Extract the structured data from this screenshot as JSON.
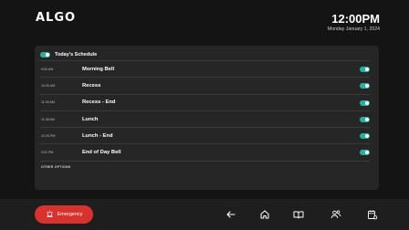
{
  "header": {
    "logo": "ALGO",
    "time": "12:00PM",
    "date": "Monday January 1, 2024"
  },
  "schedule": {
    "title": "Today's Schedule",
    "enabled": true,
    "events": [
      {
        "time": "9:00 AM",
        "name": "Morning Bell",
        "enabled": true
      },
      {
        "time": "10:30 AM",
        "name": "Recess",
        "enabled": true
      },
      {
        "time": "11:00 AM",
        "name": "Recess - End",
        "enabled": true
      },
      {
        "time": "11:45 AM",
        "name": "Lunch",
        "enabled": true
      },
      {
        "time": "12:25 PM",
        "name": "Lunch - End",
        "enabled": true
      },
      {
        "time": "3:01 PM",
        "name": "End of Day Bell",
        "enabled": true
      }
    ],
    "other_options_label": "OTHER OPTIONS"
  },
  "footer": {
    "emergency_label": "Emergency",
    "icons": [
      "back-arrow-icon",
      "home-icon",
      "book-icon",
      "users-icon",
      "calendar-settings-icon"
    ]
  },
  "colors": {
    "accent": "#29b1a0",
    "emergency": "#d8322f",
    "background": "#141414",
    "panel": "#262626"
  }
}
